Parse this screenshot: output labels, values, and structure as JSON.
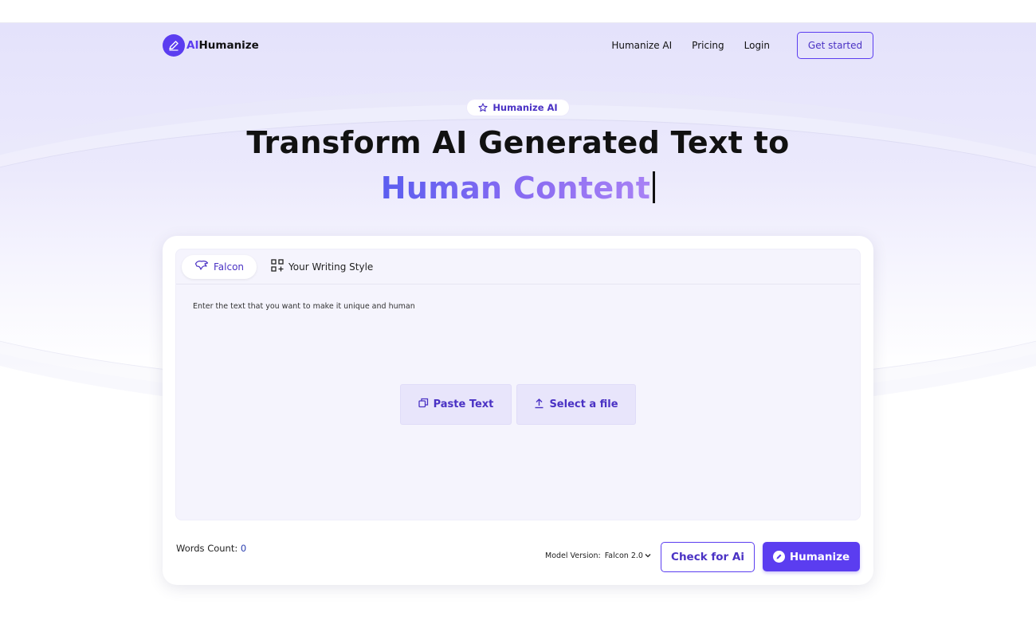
{
  "brand": {
    "prefix": "AI",
    "name": "Humanize"
  },
  "nav": {
    "links": [
      "Humanize AI",
      "Pricing",
      "Login"
    ],
    "cta": "Get started"
  },
  "hero": {
    "badge": "Humanize AI",
    "title_line1": "Transform AI Generated Text to",
    "title_line2": "Human Content"
  },
  "editor": {
    "tabs": [
      {
        "label": "Falcon",
        "icon": "falcon-icon",
        "active": true
      },
      {
        "label": "Your Writing Style",
        "icon": "grid-plus-icon",
        "active": false
      }
    ],
    "placeholder": "Enter the text that you want to make it unique and human",
    "paste_label": "Paste Text",
    "file_label": "Select a file"
  },
  "footer": {
    "words_label": "Words Count:",
    "words_value": "0",
    "model_label": "Model Version:",
    "model_value": "Falcon 2.0",
    "check_label": "Check for Ai",
    "humanize_label": "Humanize"
  },
  "colors": {
    "accent": "#5b3df0",
    "accent_text": "#4a32c4",
    "soft": "#e8e5fb"
  }
}
